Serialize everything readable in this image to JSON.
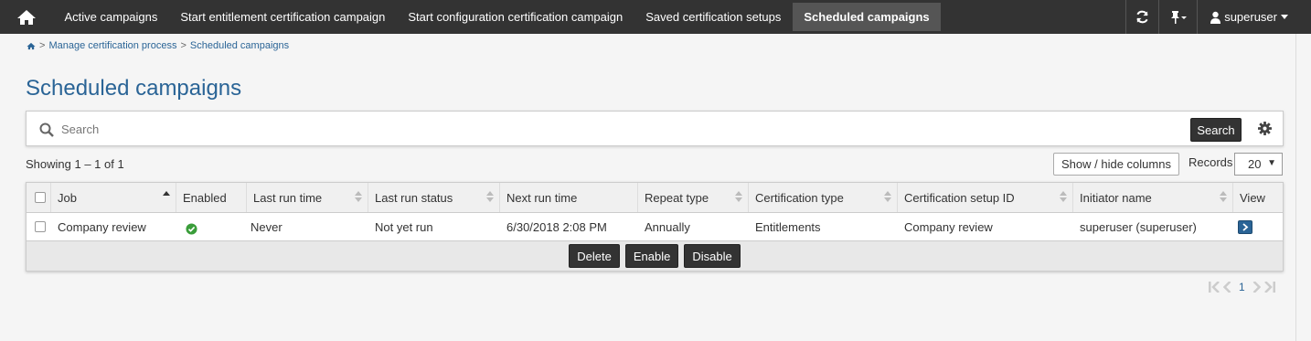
{
  "nav": {
    "home_icon": "home-icon",
    "items": [
      {
        "label": "Active campaigns"
      },
      {
        "label": "Start entitlement certification campaign"
      },
      {
        "label": "Start configuration certification campaign"
      },
      {
        "label": "Saved certification setups"
      },
      {
        "label": "Scheduled campaigns",
        "active": true
      }
    ],
    "user": "superuser"
  },
  "breadcrumb": {
    "parent": "Manage certification process",
    "separator": ">",
    "current": "Scheduled campaigns"
  },
  "page_title": "Scheduled campaigns",
  "search": {
    "placeholder": "Search",
    "button": "Search"
  },
  "showing": "Showing 1 – 1 of 1",
  "show_hide_label": "Show / hide columns",
  "records": {
    "label": "Records",
    "value": "20"
  },
  "table": {
    "columns": [
      "Job",
      "Enabled",
      "Last run time",
      "Last run status",
      "Next run time",
      "Repeat type",
      "Certification type",
      "Certification setup ID",
      "Initiator name",
      "View"
    ],
    "rows": [
      {
        "job": "Company review",
        "enabled": true,
        "last_run_time": "Never",
        "last_run_status": "Not yet run",
        "next_run_time": "6/30/2018 2:08 PM",
        "repeat_type": "Annually",
        "certification_type": "Entitlements",
        "certification_setup_id": "Company review",
        "initiator_name": "superuser (superuser)"
      }
    ],
    "actions": [
      "Delete",
      "Enable",
      "Disable"
    ]
  },
  "pager": {
    "current_page": "1"
  },
  "colors": {
    "nav_bg": "#333333",
    "accent": "#2a6496",
    "enabled_green": "#3a9d3a"
  }
}
